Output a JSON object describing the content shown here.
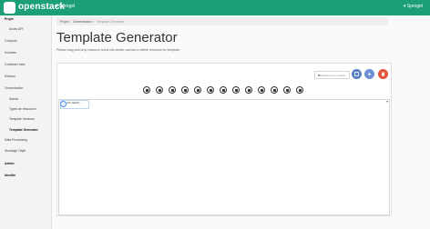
{
  "header": {
    "logo_text": "openstack",
    "project": "▾ Sprogel",
    "user": "▾ Sprogel",
    "bg": "#1c9f78"
  },
  "sidebar": {
    "items": [
      {
        "label": "Projet",
        "level": "main"
      },
      {
        "label": "Accès API",
        "level": "sub"
      },
      {
        "label": "Compute",
        "level": "sub"
      },
      {
        "label": "Volumes",
        "level": "sub"
      },
      {
        "label": "Container Infra",
        "level": "sub"
      },
      {
        "label": "Réseau",
        "level": "sub"
      },
      {
        "label": "Orchestration",
        "level": "sub"
      },
      {
        "label": "Stacks",
        "level": "sub2"
      },
      {
        "label": "Types de ressource",
        "level": "sub2"
      },
      {
        "label": "Template Versions",
        "level": "sub2"
      },
      {
        "label": "Template Generator",
        "level": "active"
      },
      {
        "label": "Data Processing",
        "level": "sub"
      },
      {
        "label": "Stockage Objet",
        "level": "sub"
      },
      {
        "label": "Admin",
        "level": "main"
      },
      {
        "label": "Identité",
        "level": "main"
      }
    ]
  },
  "breadcrumb": [
    "Projet",
    "Orchestration",
    "Template Generator"
  ],
  "page": {
    "title": "Template Generator",
    "subtitle": "Please drag and drop resource icons into center canvas to define resource for template."
  },
  "toolbar": {
    "select_placeholder": "Sélectionner la version",
    "buttons": [
      {
        "icon": "save-icon",
        "color": "#5a7fc4"
      },
      {
        "icon": "download-icon",
        "color": "#6f8fd6"
      },
      {
        "icon": "trash-icon",
        "color": "#e5533b"
      }
    ]
  },
  "resource_icons": [
    "server-icon",
    "network-icon",
    "subnet-icon",
    "port-icon",
    "router-icon",
    "cloud-icon",
    "volume-icon",
    "security-group-icon",
    "key-icon",
    "floating-ip-icon",
    "load-balancer-icon",
    "firewall-icon",
    "stack-icon"
  ],
  "canvas": {
    "root_label": "OS::HEAT::..."
  }
}
